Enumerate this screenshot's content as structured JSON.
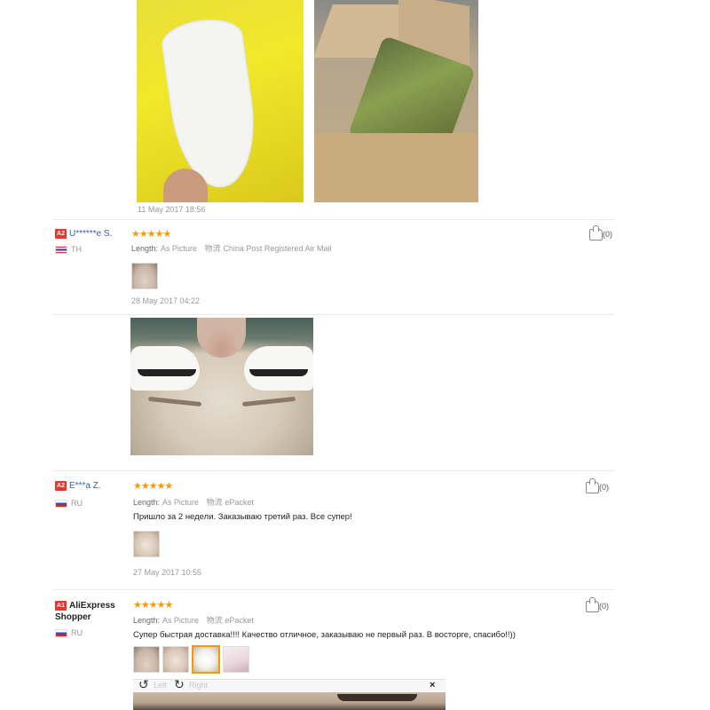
{
  "top_review": {
    "timestamp": "11 May 2017 18:56"
  },
  "reviews": [
    {
      "badge": "A2",
      "name": "U******e S.",
      "country": "TH",
      "rating": "★★★★★",
      "length_label": "Length:",
      "length_value": "As Picture",
      "shipping_label": "物流",
      "shipping_value": "China Post Registered Air Mail",
      "text": "",
      "likes": "(0)",
      "timestamp": "28 May 2017 04:22"
    },
    {
      "badge": "A2",
      "name": "E***a Z.",
      "country": "RU",
      "rating": "★★★★★",
      "length_label": "Length:",
      "length_value": "As Picture",
      "shipping_label": "物流",
      "shipping_value": "ePacket",
      "text": "Пришло за 2 недели. Заказываю третий раз. Все супер!",
      "likes": "(0)",
      "timestamp": "27 May 2017 10:55"
    },
    {
      "badge": "A1",
      "name_line1": "AliExpress",
      "name_line2": "Shopper",
      "country": "RU",
      "rating": "★★★★★",
      "length_label": "Length:",
      "length_value": "As Picture",
      "shipping_label": "物流",
      "shipping_value": "ePacket",
      "text": "Супер быстрая доставка!!!! Качество отличное, заказываю не первый раз. В восторге, спасибо!!))",
      "likes": "(0)"
    }
  ],
  "viewer": {
    "rotate_left_icon": "↺",
    "left_label": "Left",
    "rotate_right_icon": "↻",
    "right_label": "Right",
    "close_label": "×"
  }
}
